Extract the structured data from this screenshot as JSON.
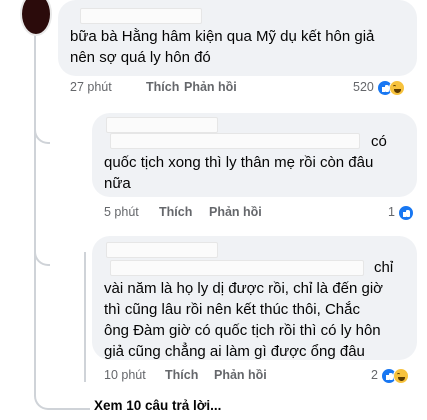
{
  "comments": [
    {
      "text_lines": [
        "bữa bà Hằng hâm kiện qua Mỹ dụ kết hôn giả",
        "nên sợ quá ly hôn đó"
      ],
      "time": "27 phút",
      "like": "Thích",
      "reply": "Phản hồi",
      "reaction_count": "520"
    },
    {
      "text_lines": [
        "có",
        "quốc tịch xong thì ly thân mẹ rồi còn đâu",
        "nữa"
      ],
      "time": "5 phút",
      "like": "Thích",
      "reply": "Phản hồi",
      "reaction_count": "1"
    },
    {
      "text_lines": [
        "chỉ",
        "vài năm là họ ly dị được rồi, chỉ là đến giờ",
        "thì cũng lâu rồi nên kết thúc thôi, Chắc",
        "ông Đàm giờ có quốc tịch rồi thì có ly hôn",
        "giả cũng chẳng ai làm gì được ổng đâu"
      ],
      "time": "10 phút",
      "like": "Thích",
      "reply": "Phản hồi",
      "reaction_count": "2"
    }
  ],
  "view_more": "Xem 10 câu trả lời...",
  "icons": [
    "like-icon",
    "haha-icon"
  ],
  "colors": {
    "bubble": "#f0f2f5",
    "meta": "#65676b",
    "like": "#1877f2",
    "haha": "#f7c23d"
  }
}
